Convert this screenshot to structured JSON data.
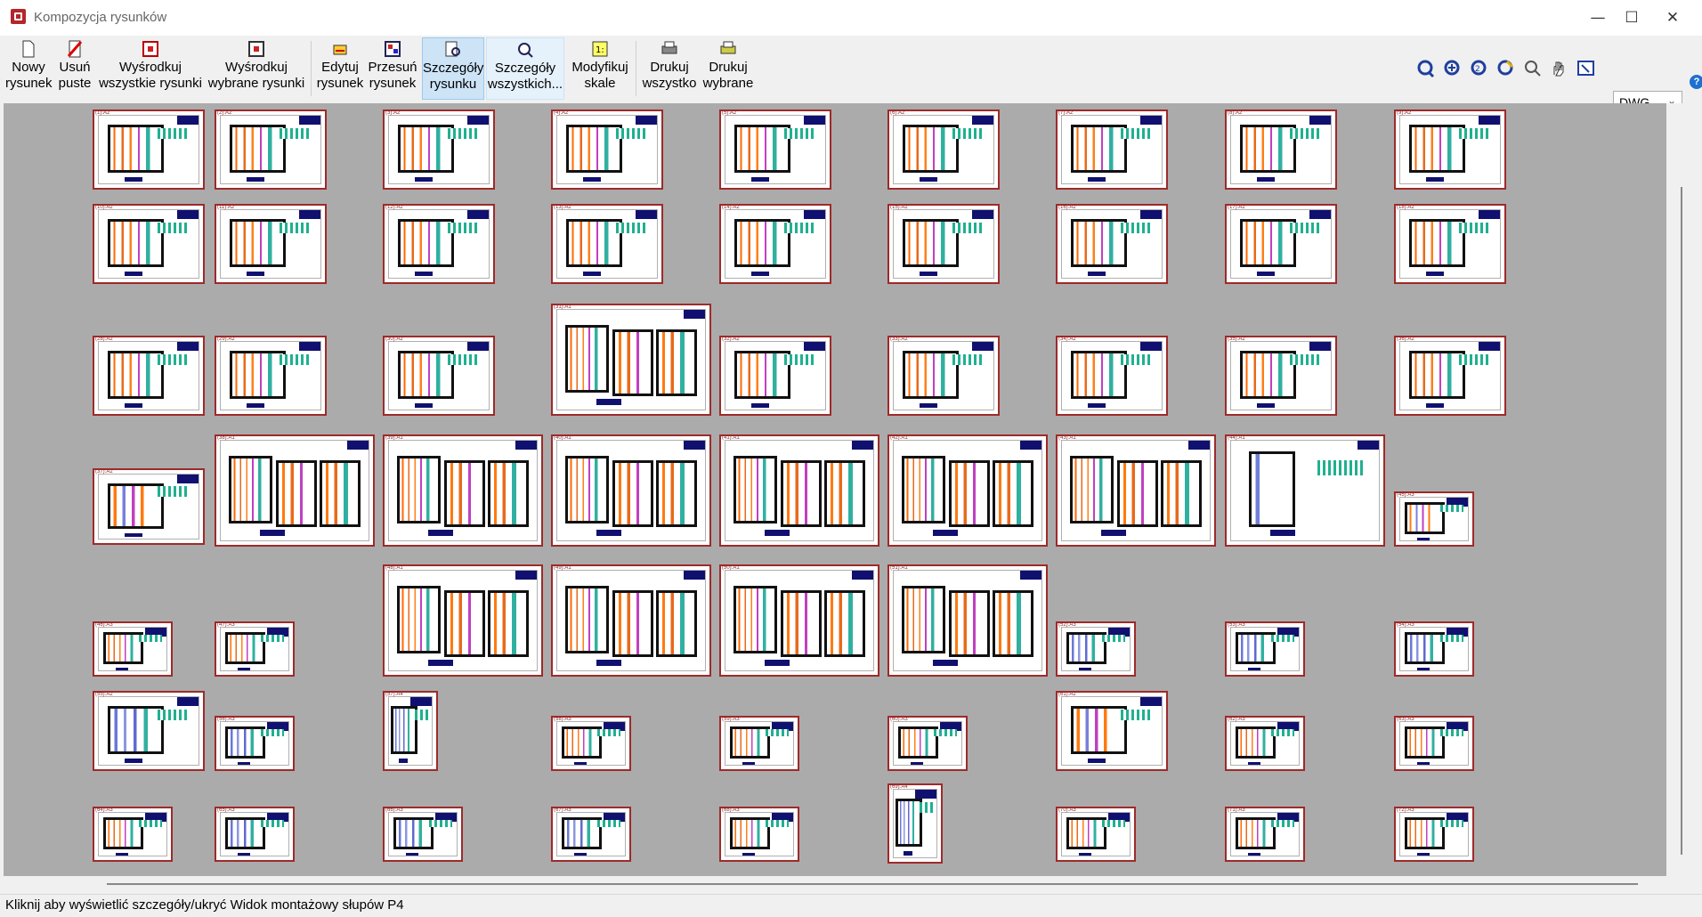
{
  "window": {
    "title": "Kompozycja rysunków",
    "minimize": "—",
    "maximize": "☐",
    "close": "✕"
  },
  "toolbar": {
    "new_drawing": "Nowy\nrysunek",
    "remove_empty": "Usuń\npuste",
    "center_all": "Wyśrodkuj\nwszystkie rysunki",
    "center_selected": "Wyśrodkuj\nwybrane rysunki",
    "edit_drawing": "Edytuj\nrysunek",
    "move_drawing": "Przesuń\nrysunek",
    "drawing_details": "Szczegóły\nrysunku",
    "all_details": "Szczegóły\nwszystkich...",
    "modify_scales": "Modyfikuj\nskale",
    "print_all": "Drukuj\nwszystko",
    "print_selected": "Drukuj\nwybrane",
    "format_value": "DWG",
    "help": "?"
  },
  "sheets": [
    {
      "label": "(1):A2"
    },
    {
      "label": "(2):A2"
    },
    {
      "label": "(3):A2"
    },
    {
      "label": "(4):A2"
    },
    {
      "label": "(5):A2"
    },
    {
      "label": "(6):A2"
    },
    {
      "label": "(7):A2"
    },
    {
      "label": "(8):A2"
    },
    {
      "label": "(9):A2"
    },
    {
      "label": "(10):A2"
    },
    {
      "label": "(11):A2"
    },
    {
      "label": "(12):A2"
    },
    {
      "label": "(13):A2"
    },
    {
      "label": "(14):A2"
    },
    {
      "label": "(15):A2"
    },
    {
      "label": "(16):A2"
    },
    {
      "label": "(17):A2"
    },
    {
      "label": "(18):A2"
    },
    {
      "label": "(28):A2"
    },
    {
      "label": "(29):A2"
    },
    {
      "label": "(30):A2"
    },
    {
      "label": "(31):A1"
    },
    {
      "label": "(32):A2"
    },
    {
      "label": "(33):A2"
    },
    {
      "label": "(34):A2"
    },
    {
      "label": "(35):A2"
    },
    {
      "label": "(36):A2"
    },
    {
      "label": "(37):A2"
    },
    {
      "label": "(38):A1"
    },
    {
      "label": "(39):A1"
    },
    {
      "label": "(40):A1"
    },
    {
      "label": "(41):A1"
    },
    {
      "label": "(42):A1"
    },
    {
      "label": "(43):A1"
    },
    {
      "label": "(44):A1"
    },
    {
      "label": "(45):A3"
    },
    {
      "label": "(48):A1"
    },
    {
      "label": "(49):A1"
    },
    {
      "label": "(50):A1"
    },
    {
      "label": "(51):A1"
    },
    {
      "label": "(46):A3"
    },
    {
      "label": "(47):A3"
    },
    {
      "label": "(52):A3"
    },
    {
      "label": "(53):A3"
    },
    {
      "label": "(54):A3"
    },
    {
      "label": "(55):A2"
    },
    {
      "label": "(56):A3"
    },
    {
      "label": "(57):A4"
    },
    {
      "label": "(58):A3"
    },
    {
      "label": "(59):A3"
    },
    {
      "label": "(60):A3"
    },
    {
      "label": "(61):A2"
    },
    {
      "label": "(62):A3"
    },
    {
      "label": "(63):A3"
    },
    {
      "label": "(64):A3"
    },
    {
      "label": "(65):A3"
    },
    {
      "label": "(66):A3"
    },
    {
      "label": "(67):A3"
    },
    {
      "label": "(68):A3"
    },
    {
      "label": "(69):A4"
    },
    {
      "label": "(70):A3"
    },
    {
      "label": "(71):A3"
    },
    {
      "label": "(72):A3"
    }
  ],
  "status": {
    "text": "Kliknij aby wyświetlić szczegóły/ukryć Widok montażowy słupów P4"
  }
}
